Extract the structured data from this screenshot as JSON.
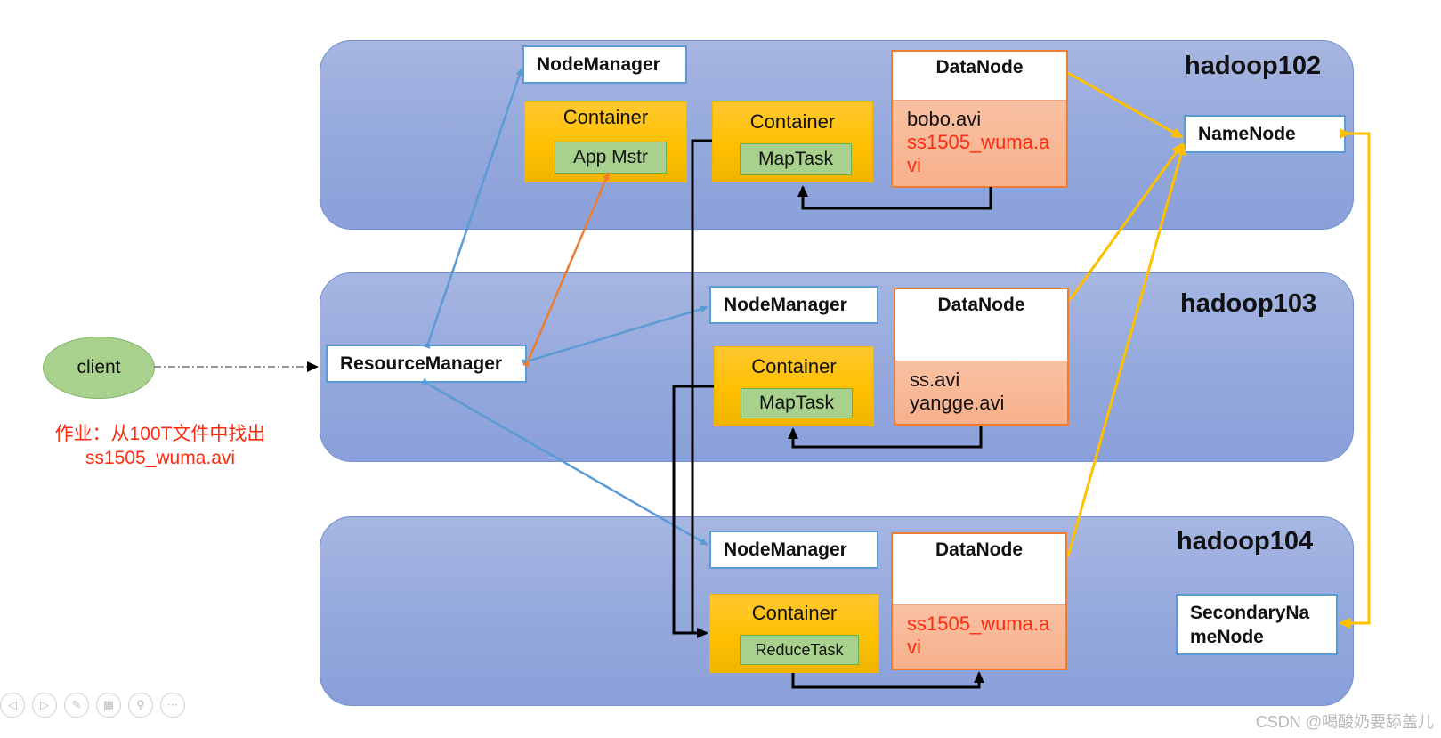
{
  "hosts": [
    {
      "label": "hadoop102"
    },
    {
      "label": "hadoop103"
    },
    {
      "label": "hadoop104"
    }
  ],
  "client": {
    "label": "client"
  },
  "homework": {
    "line1": "作业：从100T文件中找出",
    "line2": "ss1505_wuma.avi"
  },
  "resource_manager": {
    "label": "ResourceManager"
  },
  "namenode": {
    "label": "NameNode"
  },
  "secondary_namenode": {
    "line1": "SecondaryNa",
    "line2": "meNode"
  },
  "nodemanagers": [
    {
      "label": "NodeManager"
    },
    {
      "label": "NodeManager"
    },
    {
      "label": "NodeManager"
    }
  ],
  "containers": [
    {
      "title": "Container",
      "task": "App Mstr"
    },
    {
      "title": "Container",
      "task": "MapTask"
    },
    {
      "title": "Container",
      "task": "MapTask"
    },
    {
      "title": "Container",
      "task": "ReduceTask"
    }
  ],
  "datanodes": [
    {
      "title": "DataNode",
      "files": [
        {
          "text": "bobo.avi",
          "highlight": false
        },
        {
          "text": "ss1505_wuma.a",
          "highlight": true
        },
        {
          "text": "vi",
          "highlight": true
        }
      ]
    },
    {
      "title": "DataNode",
      "files": [
        {
          "text": "ss.avi",
          "highlight": false
        },
        {
          "text": "yangge.avi",
          "highlight": false
        }
      ]
    },
    {
      "title": "DataNode",
      "files": [
        {
          "text": "ss1505_wuma.a",
          "highlight": true
        },
        {
          "text": "vi",
          "highlight": true
        }
      ]
    }
  ],
  "colors": {
    "rpc_arrow": "#5b9bd5",
    "appmaster_arrow": "#ed7d31",
    "hdfs_arrow": "#ffc000",
    "data_flow": "#000000",
    "highlight_text": "#ff2a10"
  },
  "toolbar": {
    "buttons": [
      {
        "icon": "prev-icon",
        "glyph": "◁"
      },
      {
        "icon": "next-icon",
        "glyph": "▷"
      },
      {
        "icon": "pen-icon",
        "glyph": "✎"
      },
      {
        "icon": "slides-icon",
        "glyph": "▦"
      },
      {
        "icon": "zoom-icon",
        "glyph": "⚲"
      },
      {
        "icon": "more-icon",
        "glyph": "⋯"
      }
    ]
  },
  "watermark": "CSDN @喝酸奶要舔盖儿"
}
